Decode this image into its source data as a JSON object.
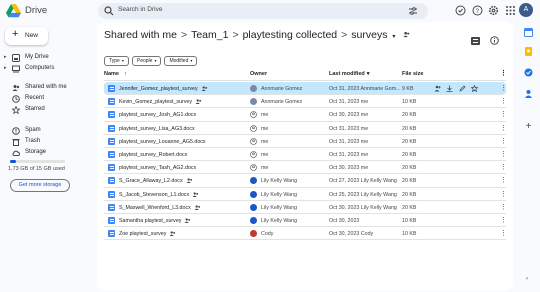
{
  "app": {
    "name": "Drive"
  },
  "search": {
    "placeholder": "Search in Drive"
  },
  "sidebar": {
    "new_label": "New",
    "items": [
      {
        "label": "My Drive",
        "icon": "my-drive-icon"
      },
      {
        "label": "Computers",
        "icon": "computers-icon"
      },
      {
        "label": "Shared with me",
        "icon": "shared-icon"
      },
      {
        "label": "Recent",
        "icon": "clock-icon"
      },
      {
        "label": "Starred",
        "icon": "star-icon"
      },
      {
        "label": "Spam",
        "icon": "spam-icon"
      },
      {
        "label": "Trash",
        "icon": "trash-icon"
      },
      {
        "label": "Storage",
        "icon": "cloud-icon"
      }
    ],
    "storage_text": "1.73 GB of 15 GB used",
    "storage_fraction": 0.115,
    "get_storage_label": "Get more storage"
  },
  "breadcrumb": {
    "items": [
      "Shared with me",
      "Team_1",
      "playtesting collected",
      "surveys"
    ],
    "separator": ">"
  },
  "filters": [
    "Type",
    "People",
    "Modified"
  ],
  "table": {
    "headers": {
      "name": "Name",
      "owner": "Owner",
      "modified": "Last modified",
      "size": "File size"
    },
    "rows": [
      {
        "name": "Jennifer_Gomez_playtest_survey",
        "owner": "Annmarie Gomez",
        "modified": "Oct 31, 2023 Annmarie Gom...",
        "size": "9 KB",
        "avatar": "#7a8aa6",
        "selected": true
      },
      {
        "name": "Kevin_Gomez_playtest_survey",
        "owner": "Annmarie Gomez",
        "modified": "Oct 31, 2023 me",
        "size": "10 KB",
        "avatar": "#7a8aa6"
      },
      {
        "name": "playtest_survey_Josh_AG1.docx",
        "owner": "me",
        "modified": "Oct 30, 2023 me",
        "size": "20 KB",
        "avatar": "none"
      },
      {
        "name": "playtest_survey_Lisa_AG3.docx",
        "owner": "me",
        "modified": "Oct 31, 2023 me",
        "size": "20 KB",
        "avatar": "none"
      },
      {
        "name": "playtest_survey_Louanne_AG5.docx",
        "owner": "me",
        "modified": "Oct 31, 2023 me",
        "size": "20 KB",
        "avatar": "none"
      },
      {
        "name": "playtest_survey_Robert.docx",
        "owner": "me",
        "modified": "Oct 31, 2023 me",
        "size": "20 KB",
        "avatar": "none"
      },
      {
        "name": "playtest_survey_Tash_AG2.docx",
        "owner": "me",
        "modified": "Oct 30, 2023 me",
        "size": "20 KB",
        "avatar": "none"
      },
      {
        "name": "S_Grace_Allaway_L2.docx",
        "owner": "Lily Kelly Wang",
        "modified": "Oct 27, 2023 Lily Kelly Wang",
        "size": "20 KB",
        "avatar": "#1a56c9"
      },
      {
        "name": "S_Jacob_Stevenson_L1.docx",
        "owner": "Lily Kelly Wang",
        "modified": "Oct 25, 2023 Lily Kelly Wang",
        "size": "20 KB",
        "avatar": "#1a56c9"
      },
      {
        "name": "S_Maxwell_Wrenford_L3.docx",
        "owner": "Lily Kelly Wang",
        "modified": "Oct 30, 2023 Lily Kelly Wang",
        "size": "20 KB",
        "avatar": "#1a56c9"
      },
      {
        "name": "Samantha playtest_survey",
        "owner": "Lily Kelly Wang",
        "modified": "Oct 30, 2023",
        "size": "10 KB",
        "avatar": "#1a56c9"
      },
      {
        "name": "Zoe playtest_survey",
        "owner": "Cody",
        "modified": "Oct 30, 2023 Cody",
        "size": "10 KB",
        "avatar": "#c0392b"
      }
    ]
  },
  "colors": {
    "accent": "#0b57d0",
    "selected_row": "#c2e7ff",
    "panel": "#ffffff",
    "background": "#f8fafd"
  }
}
